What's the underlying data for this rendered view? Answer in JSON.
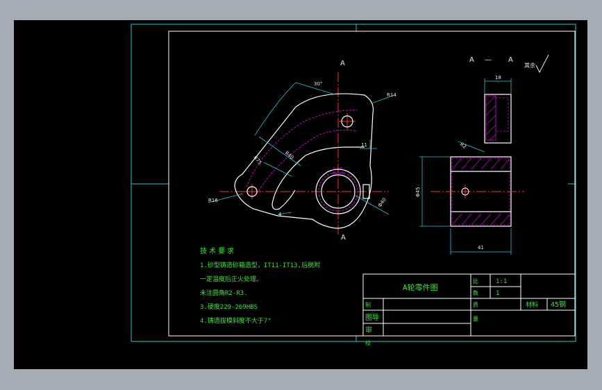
{
  "colors": {
    "frame": "#27c7cf",
    "outline": "#ffffff",
    "center_line": "#ff3030",
    "hidden": "#d000d0",
    "hatch": "#d000d0",
    "dimension": "#27c7cf",
    "note_text": "#39e639",
    "background": "#000000",
    "window": "#a6acb6"
  },
  "section": {
    "label_left": "A",
    "label_dash": "—",
    "label_right": "A",
    "roughness_note": "其余",
    "top_width": "18",
    "height": "Φ45",
    "bottom_width": "41",
    "chamfer": "R2"
  },
  "main_view": {
    "cut_top": "A",
    "cut_bottom": "A",
    "angle_dim": "30°",
    "radius_top": "R14",
    "dim_right": "11",
    "radius_left": "R16",
    "arc_mid": "R40",
    "arc_inner": "R75",
    "dia_hole": "Φ40",
    "small_dim": "4"
  },
  "tech_notes": {
    "heading": "技术要求",
    "line1": "1.砂型铸造砂箱造型，IT11-IT13,后脱附",
    "line2": "一定温度后正火处理。",
    "line3": "未注圆角R2-R3.",
    "line4": "3.硬度229-269HBS",
    "line5": "4.铸造拔模斜度不大于7°"
  },
  "title_block": {
    "part_name": "A轮零件图",
    "ratio_label": "比",
    "ratio_value": "1:1",
    "quantity_label": "数",
    "quantity_value": "1",
    "drawn_label": "制",
    "review_label": "审",
    "check_label": "校",
    "guide_label": "图导",
    "mass_label": "质",
    "material_label": "材料",
    "material_value": "45钢",
    "weight_label": "量"
  }
}
